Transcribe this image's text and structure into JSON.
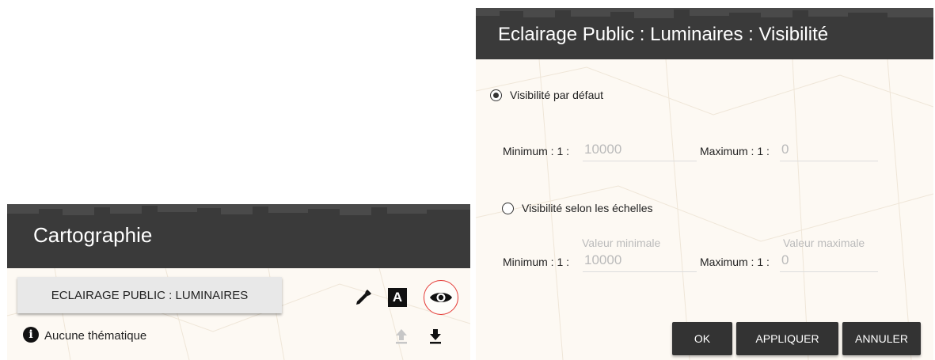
{
  "cartography": {
    "title": "Cartographie",
    "layer_button_label": "ECLAIRAGE PUBLIC : LUMINAIRES",
    "label_icon_glyph": "A",
    "info_glyph": "i",
    "no_theme_label": "Aucune thématique",
    "icons": {
      "picker": "eyedropper-icon",
      "label": "text-label-icon",
      "visibility": "eye-icon",
      "info": "info-icon",
      "upload": "upload-icon",
      "download": "download-icon"
    }
  },
  "visibility_dialog": {
    "title": "Eclairage Public : Luminaires : Visibilité",
    "default_option": {
      "label": "Visibilité par défaut",
      "selected": true,
      "min_label": "Minimum : 1 :",
      "min_value": "10000",
      "max_label": "Maximum : 1 :",
      "max_value": "0"
    },
    "scale_option": {
      "label": "Visibilité selon les échelles",
      "selected": false,
      "min_caption": "Valeur minimale",
      "max_caption": "Valeur maximale",
      "min_label": "Minimum : 1 :",
      "min_value": "10000",
      "max_label": "Maximum : 1 :",
      "max_value": "0"
    },
    "buttons": {
      "ok": "OK",
      "apply": "APPLIQUER",
      "cancel": "ANNULER"
    }
  },
  "colors": {
    "header_bg": "#3a3a3a",
    "button_dark": "#333333",
    "highlight_circle": "#e53935",
    "map_bg": "#fdf9f3"
  }
}
